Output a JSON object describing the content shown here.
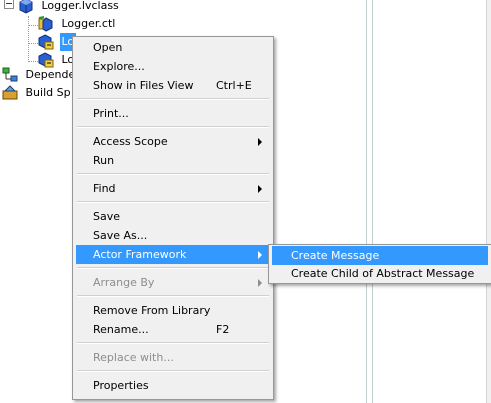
{
  "tree": {
    "items": [
      {
        "label": "Logger.lvclass",
        "icon": "lvclass-cube-icon"
      },
      {
        "label": "Logger.ctl",
        "icon": "control-icon"
      },
      {
        "label": "Lo",
        "icon": "vi-icon",
        "selected": true
      },
      {
        "label": "Lo",
        "icon": "vi-icon"
      },
      {
        "label": "Depende",
        "icon": "dependencies-icon"
      },
      {
        "label": "Build Sp",
        "icon": "build-specs-icon"
      }
    ]
  },
  "context_menu": {
    "open": "Open",
    "explore": "Explore...",
    "show_in_files": "Show in Files View",
    "show_in_files_shortcut": "Ctrl+E",
    "print": "Print...",
    "access_scope": "Access Scope",
    "run": "Run",
    "find": "Find",
    "save": "Save",
    "save_as": "Save As...",
    "actor_framework": "Actor Framework",
    "arrange_by": "Arrange By",
    "remove_from_library": "Remove From Library",
    "rename": "Rename...",
    "rename_shortcut": "F2",
    "replace_with": "Replace with...",
    "properties": "Properties"
  },
  "submenu": {
    "create_message": "Create Message",
    "create_child_abstract": "Create Child of Abstract Message"
  },
  "colors": {
    "highlight": "#3399ff",
    "menu_bg": "#f0f0f0",
    "disabled_text": "#8d8d8d"
  }
}
